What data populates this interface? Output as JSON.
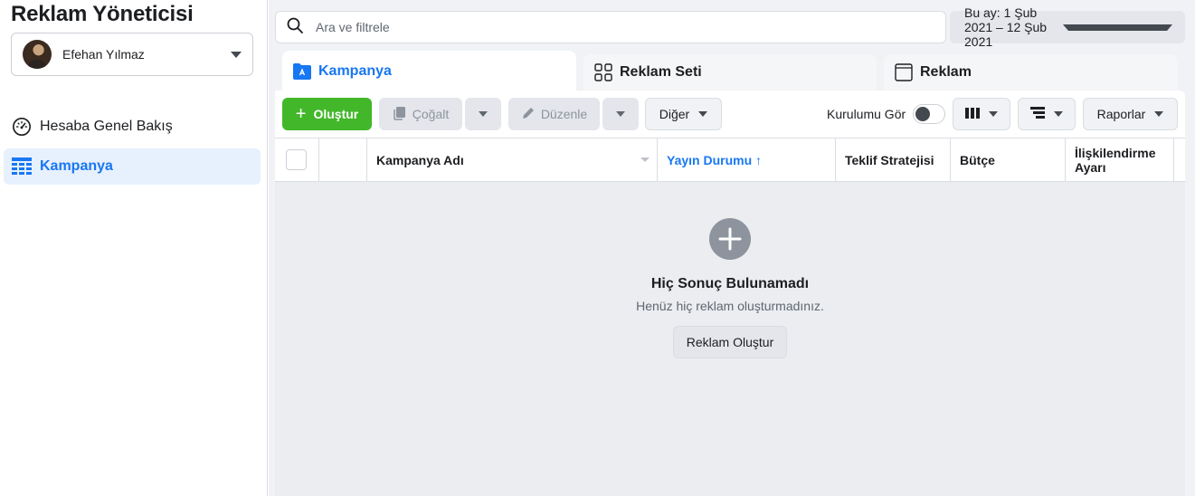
{
  "app": {
    "title": "Reklam Yöneticisi"
  },
  "account": {
    "name": "Efehan Yılmaz"
  },
  "sidebar": {
    "items": [
      {
        "label": "Hesaba Genel Bakış",
        "icon": "gauge-icon"
      },
      {
        "label": "Kampanya",
        "icon": "table-grid-icon",
        "active": true
      }
    ]
  },
  "search": {
    "placeholder": "Ara ve filtrele",
    "value": ""
  },
  "date_range": {
    "label": "Bu ay: 1 Şub 2021 – 12 Şub 2021"
  },
  "tabs": [
    {
      "label": "Kampanya",
      "active": true
    },
    {
      "label": "Reklam Seti"
    },
    {
      "label": "Reklam"
    }
  ],
  "toolbar": {
    "create_label": "Oluştur",
    "duplicate_label": "Çoğalt",
    "edit_label": "Düzenle",
    "more_label": "Diğer",
    "setup_label": "Kurulumu Gör",
    "setup_enabled": false,
    "reports_label": "Raporlar"
  },
  "table": {
    "columns": [
      "Kampanya Adı",
      "Yayın Durumu ↑",
      "Teklif Stratejisi",
      "Bütçe",
      "İlişkilendirme Ayarı"
    ]
  },
  "empty_state": {
    "title": "Hiç Sonuç Bulunamadı",
    "subtitle": "Henüz hiç reklam oluşturmadınız.",
    "button_label": "Reklam Oluştur"
  },
  "colors": {
    "accent": "#1877f2",
    "create_green": "#42b72a",
    "active_bg": "#e7f0fd",
    "main_bg": "#f0f2f5"
  }
}
